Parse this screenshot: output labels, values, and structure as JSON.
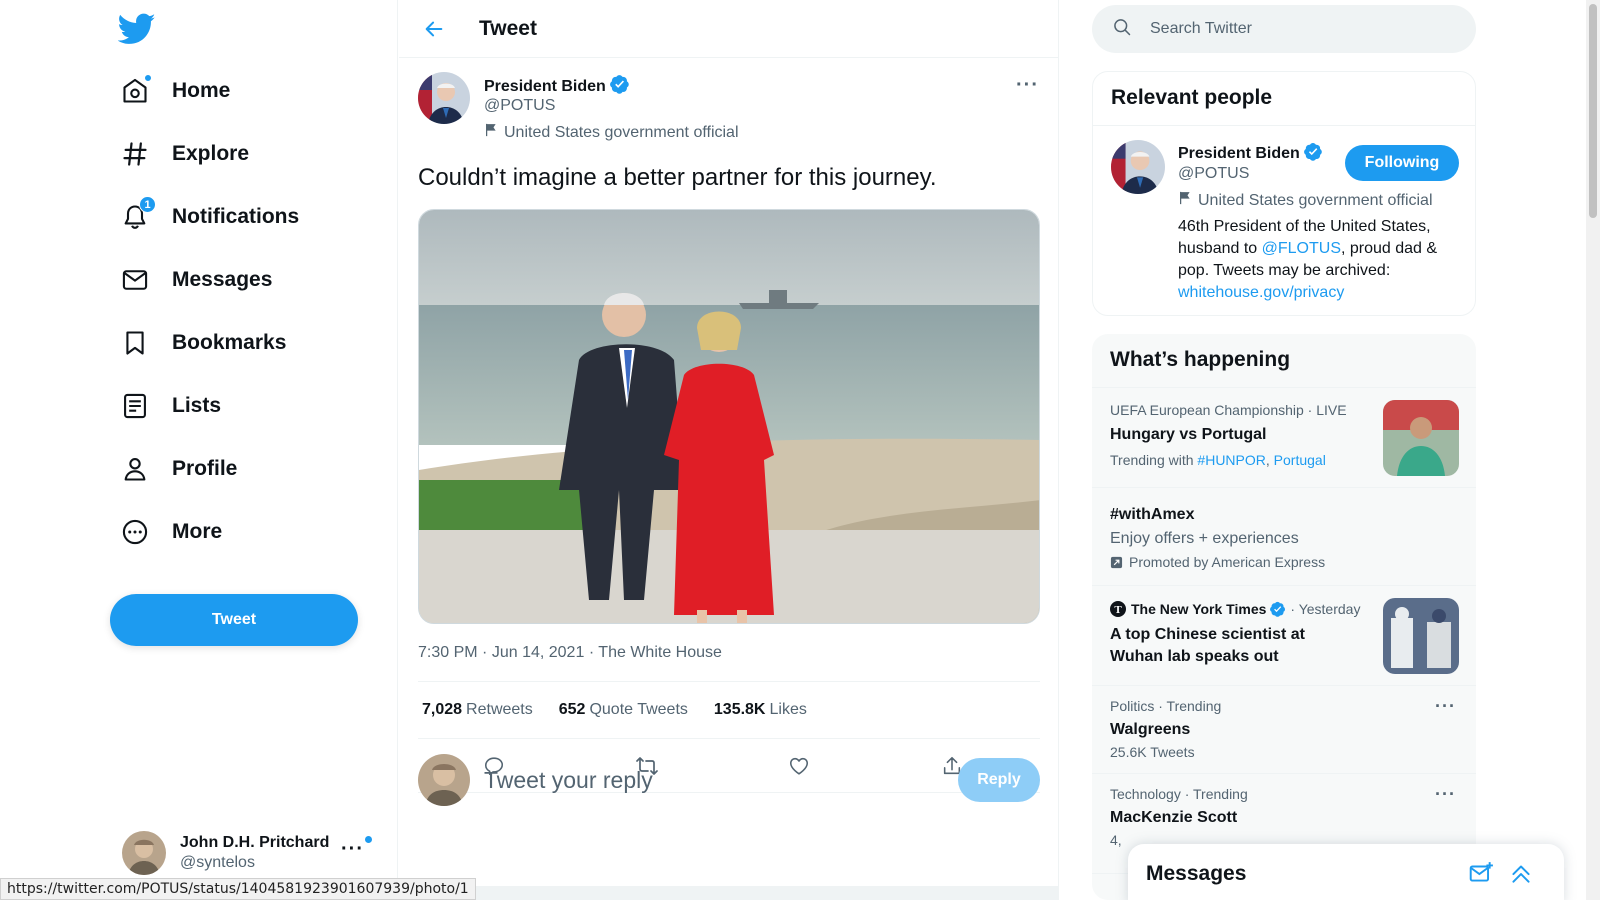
{
  "nav": {
    "items": [
      {
        "label": "Home",
        "icon": "home-icon"
      },
      {
        "label": "Explore",
        "icon": "hashtag-icon"
      },
      {
        "label": "Notifications",
        "icon": "bell-icon",
        "badge": "1"
      },
      {
        "label": "Messages",
        "icon": "mail-icon"
      },
      {
        "label": "Bookmarks",
        "icon": "bookmark-icon"
      },
      {
        "label": "Lists",
        "icon": "list-icon"
      },
      {
        "label": "Profile",
        "icon": "person-icon"
      },
      {
        "label": "More",
        "icon": "more-circle-icon"
      }
    ],
    "tweet_button": "Tweet",
    "account": {
      "name": "John D.H. Pritchard",
      "handle": "@syntelos"
    }
  },
  "main": {
    "title": "Tweet",
    "tweet": {
      "author_name": "President Biden",
      "author_handle": "@POTUS",
      "author_label": "United States government official",
      "text": "Couldn’t imagine a better partner for this journey.",
      "time": "7:30 PM",
      "date": "Jun 14, 2021",
      "source": "The White House",
      "retweets": "7,028",
      "retweets_label": "Retweets",
      "quotes": "652",
      "quotes_label": "Quote Tweets",
      "likes": "135.8K",
      "likes_label": "Likes"
    },
    "reply": {
      "placeholder": "Tweet your reply",
      "button": "Reply"
    }
  },
  "right": {
    "search_placeholder": "Search Twitter",
    "relevant": {
      "title": "Relevant people",
      "name": "President Biden",
      "handle": "@POTUS",
      "label": "United States government official",
      "follow_button": "Following",
      "bio_1": "46th President of the United States, husband to ",
      "bio_link": "@FLOTUS",
      "bio_2": ", proud dad & pop. Tweets may be archived: ",
      "bio_url": "whitehouse.gov/privacy"
    },
    "happening": {
      "title": "What’s happening",
      "t1_meta": "UEFA European Championship · LIVE",
      "t1_title": "Hungary vs Portugal",
      "t1_trending": "Trending with",
      "t1_tag1": "#HUNPOR",
      "t1_tag2": "Portugal",
      "t2_title": "#withAmex",
      "t2_desc": "Enjoy offers + experiences",
      "t2_promo": "Promoted by American Express",
      "t3_source": "The New York Times",
      "t3_time": "· Yesterday",
      "t3_title": "A top Chinese scientist at Wuhan lab speaks out",
      "t4_meta": "Politics · Trending",
      "t4_title": "Walgreens",
      "t4_count": "25.6K Tweets",
      "t5_meta": "Technology · Trending",
      "t5_title": "MacKenzie Scott",
      "t5_count": "4,"
    }
  },
  "messages_drawer": {
    "title": "Messages"
  },
  "status_url": "https://twitter.com/POTUS/status/1404581923901607939/photo/1",
  "colors": {
    "accent": "#1d9bf0",
    "text": "#0f1419",
    "muted": "#536471"
  }
}
